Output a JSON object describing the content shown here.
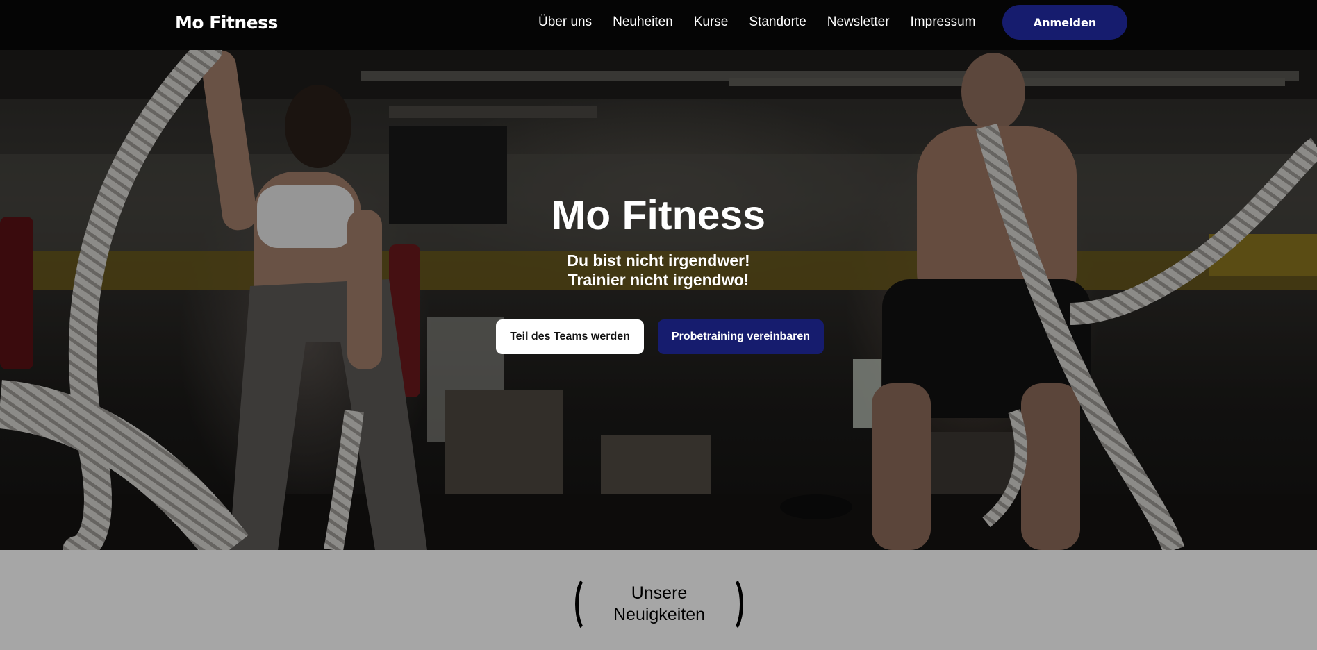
{
  "nav": {
    "brand": "Mo Fitness",
    "links": [
      "Über uns",
      "Neuheiten",
      "Kurse",
      "Standorte",
      "Newsletter",
      "Impressum"
    ],
    "login_label": "Anmelden"
  },
  "hero": {
    "title": "Mo Fitness",
    "subtitle_line1": "Du bist nicht irgendwer!",
    "subtitle_line2": "Trainier nicht irgendwo!",
    "primary_button": "Teil des Teams werden",
    "secondary_button": "Probetraining vereinbaren",
    "background_image": "gym-battle-ropes-photo"
  },
  "news": {
    "heading_line1": "Unsere",
    "heading_line2": "Neuigkeiten"
  },
  "colors": {
    "navbar": "#050505",
    "accent_navy": "#161c6e",
    "section_gray": "#a6a6a6"
  }
}
